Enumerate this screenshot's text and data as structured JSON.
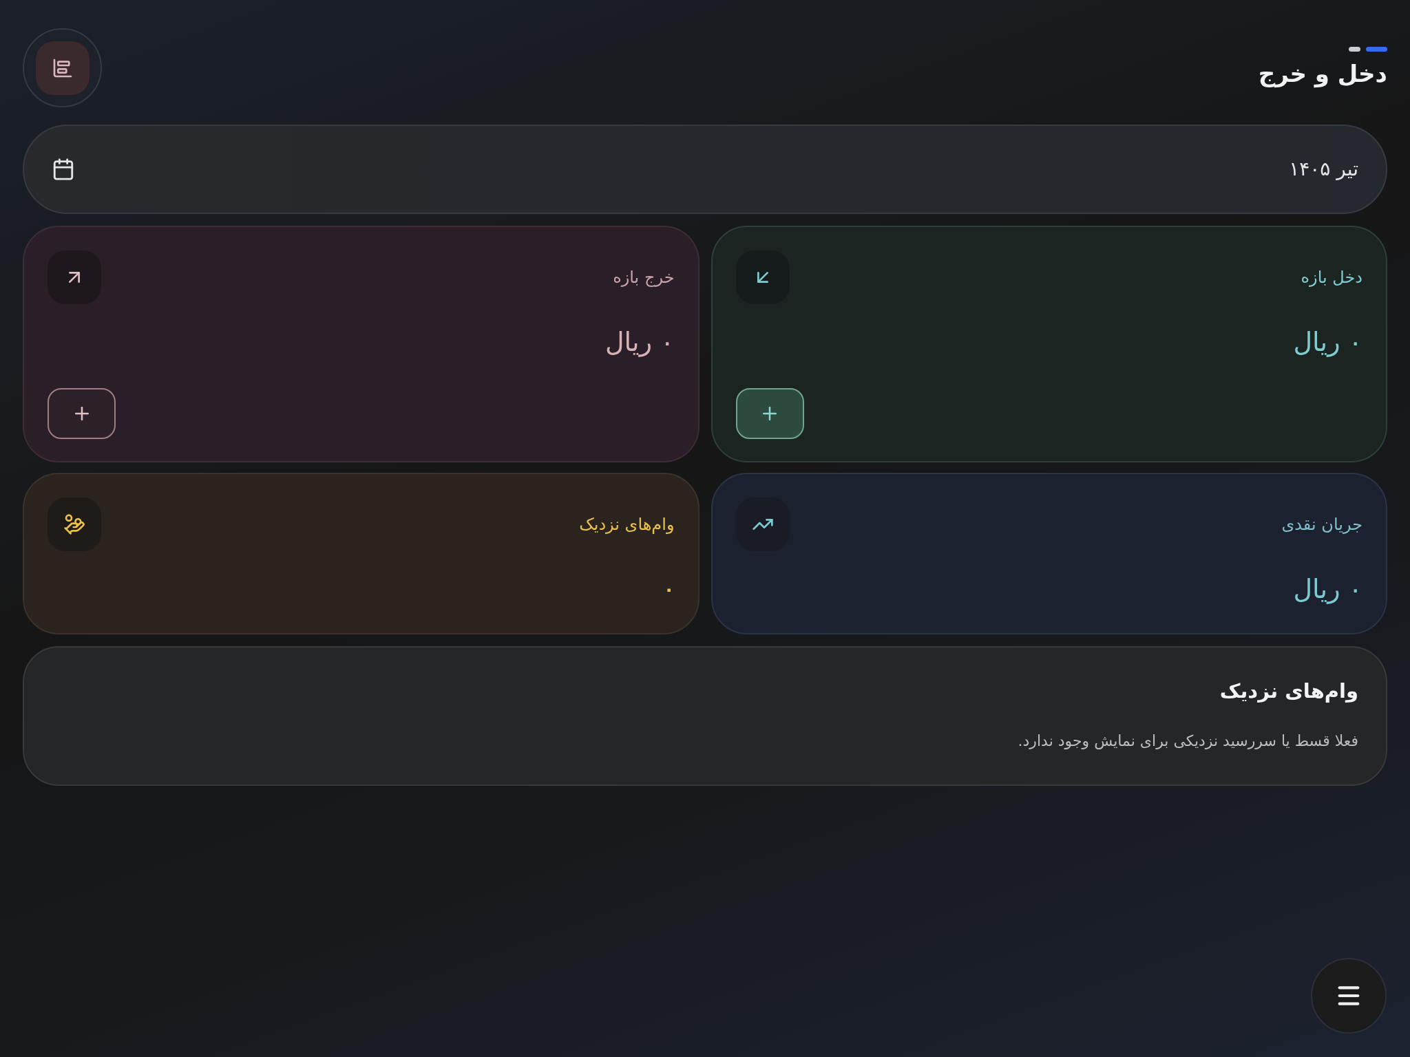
{
  "header": {
    "title": "دخل و خرج",
    "page_indicator": [
      {
        "selected": true
      },
      {
        "selected": false
      }
    ]
  },
  "period": {
    "label": "تیر ۱۴۰۵"
  },
  "cards": [
    {
      "kind": "income",
      "title": "دخل بازه",
      "value": "۰ ریال",
      "add_button": true
    },
    {
      "kind": "expense",
      "title": "خرج بازه",
      "value": "۰ ریال",
      "add_button": true
    },
    {
      "kind": "cashflow",
      "title": "جریان نقدی",
      "value": "۰ ریال",
      "add_button": false
    },
    {
      "kind": "loans",
      "title": "وام‌های نزدیک",
      "value": "۰",
      "add_button": false
    }
  ],
  "upcoming_loans": {
    "title": "وام‌های نزدیک",
    "message": "فعلا قسط یا سررسید نزدیکی برای نمایش وجود ندارد."
  }
}
